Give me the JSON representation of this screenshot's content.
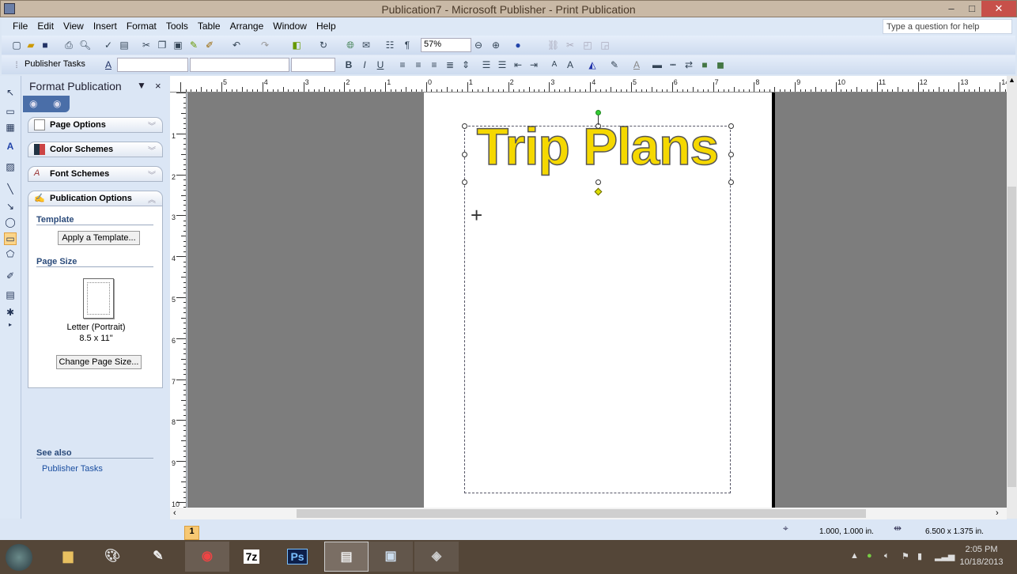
{
  "window": {
    "title": "Publication7 - Microsoft Publisher - Print Publication",
    "minimize": "–",
    "maximize": "□",
    "close": "✕"
  },
  "menu": [
    "File",
    "Edit",
    "View",
    "Insert",
    "Format",
    "Tools",
    "Table",
    "Arrange",
    "Window",
    "Help"
  ],
  "help_box": {
    "placeholder": "Type a question for help"
  },
  "toolbar": {
    "zoom": "57%",
    "publisher_tasks": "Publisher Tasks"
  },
  "ruler": {
    "h": [
      "5",
      "4",
      "3",
      "2",
      "1",
      "0",
      "1",
      "2",
      "3",
      "4",
      "5",
      "6",
      "7",
      "8",
      "9",
      "10",
      "11",
      "12",
      "13",
      "14"
    ],
    "v": [
      "1",
      "2",
      "3",
      "4",
      "5",
      "6",
      "7",
      "8",
      "9",
      "10"
    ]
  },
  "task_pane": {
    "title": "Format Publication",
    "sections": [
      "Page Options",
      "Color Schemes",
      "Font Schemes",
      "Publication Options"
    ],
    "template_label": "Template",
    "apply_template": "Apply a Template...",
    "page_size_label": "Page Size",
    "page_size_name": "Letter (Portrait)",
    "page_size_dims": "8.5 x 11\"",
    "change_page_size": "Change Page Size...",
    "see_also": "See also",
    "publisher_tasks_link": "Publisher Tasks"
  },
  "document": {
    "wordart": "Trip Plans",
    "wordart_color": "#f5d800"
  },
  "status": {
    "page": "1",
    "position": "1.000, 1.000 in.",
    "size": "6.500 x 1.375 in."
  },
  "taskbar": {
    "apps": [
      "start",
      "file-explorer",
      "paint",
      "sketch",
      "chrome",
      "7-zip",
      "photoshop",
      "publisher",
      "word",
      "media"
    ],
    "seven_zip": "7z",
    "ps": "Ps",
    "time": "2:05 PM",
    "date": "10/18/2013"
  }
}
